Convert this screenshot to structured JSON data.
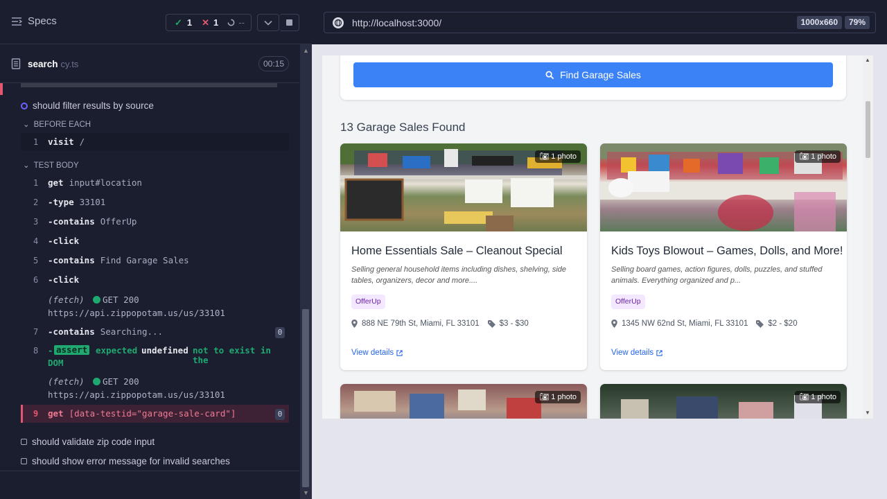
{
  "runner": {
    "specs_label": "Specs",
    "stats": {
      "passed": "1",
      "failed": "1",
      "pending": "--"
    },
    "file": {
      "name": "search",
      "ext": "cy.ts",
      "timer": "00:15"
    },
    "current_test": "should filter results by source",
    "before_each_label": "BEFORE EACH",
    "before_each": [
      {
        "num": "1",
        "cmd": "visit",
        "arg": "/"
      }
    ],
    "test_body_label": "TEST BODY",
    "commands": [
      {
        "num": "1",
        "cmd": "get",
        "arg": "input#location"
      },
      {
        "num": "2",
        "cmd": "-type",
        "arg": "33101"
      },
      {
        "num": "3",
        "cmd": "-contains",
        "arg": "OfferUp"
      },
      {
        "num": "4",
        "cmd": "-click",
        "arg": ""
      },
      {
        "num": "5",
        "cmd": "-contains",
        "arg": "Find Garage Sales"
      },
      {
        "num": "6",
        "cmd": "-click",
        "arg": ""
      },
      {
        "num": "7",
        "cmd": "-contains",
        "arg": "Searching...",
        "badge": "0"
      },
      {
        "num": "9",
        "cmd": "get",
        "arg": "[data-testid=\"garage-sale-card\"]",
        "badge": "0"
      }
    ],
    "fetch1": {
      "label": "(fetch)",
      "status": "GET 200",
      "url": "https://api.zippopotam.us/us/33101"
    },
    "fetch2": {
      "label": "(fetch)",
      "status": "GET 200",
      "url": "https://api.zippopotam.us/us/33101"
    },
    "assert": {
      "num": "8",
      "dash": "-",
      "cmd": "assert",
      "expected": "expected",
      "value": "undefined",
      "rest": "not to exist in the",
      "tail": "DOM"
    },
    "other_tests": [
      "should validate zip code input",
      "should show error message for invalid searches"
    ]
  },
  "browser": {
    "url": "http://localhost:3000/",
    "size": "1000x660",
    "zoom": "79%"
  },
  "app": {
    "find_button": "Find Garage Sales",
    "results_title": "13 Garage Sales Found",
    "cards": [
      {
        "photo_count": "1 photo",
        "title": "Home Essentials Sale – Cleanout Special",
        "desc": "Selling general household items including dishes, shelving, side tables, organizers, decor and more....",
        "source": "OfferUp",
        "address": "888 NE 79th St, Miami, FL 33101",
        "price": "$3 - $30",
        "view": "View details"
      },
      {
        "photo_count": "1 photo",
        "title": "Kids Toys Blowout – Games, Dolls, and More!",
        "desc": "Selling board games, action figures, dolls, puzzles, and stuffed animals. Everything organized and p...",
        "source": "OfferUp",
        "address": "1345 NW 62nd St, Miami, FL 33101",
        "price": "$2 - $20",
        "view": "View details"
      },
      {
        "photo_count": "1 photo"
      },
      {
        "photo_count": "1 photo"
      }
    ]
  },
  "colors": {
    "pass": "#1fa971",
    "fail": "#e45770",
    "accent": "#3b82f6",
    "tag_bg": "#f3e8ff"
  }
}
